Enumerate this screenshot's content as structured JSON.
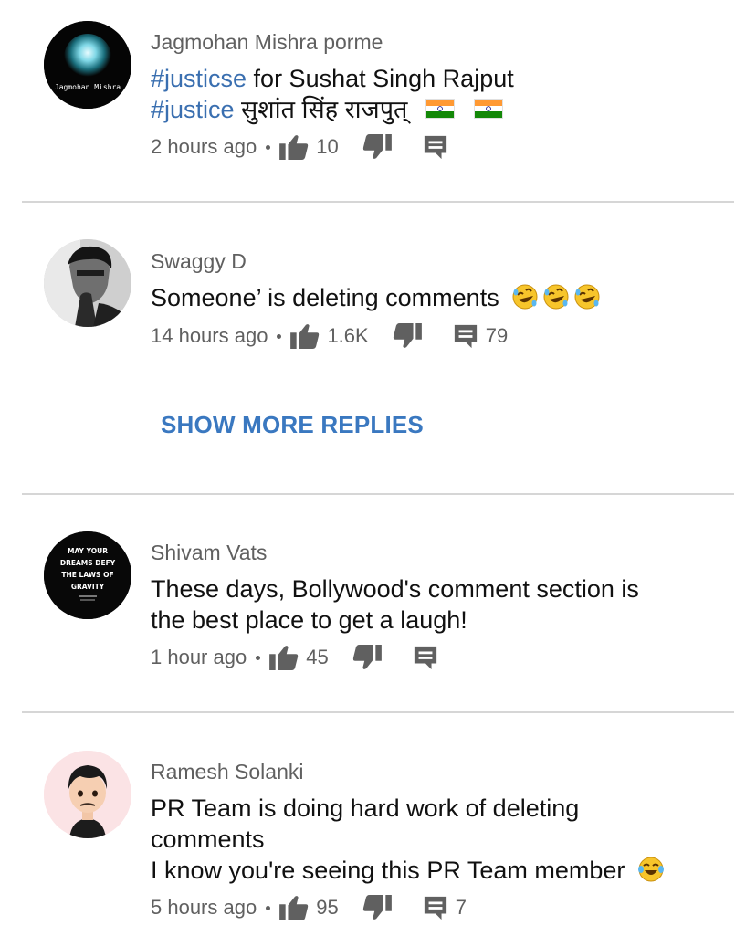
{
  "comments": [
    {
      "author": "Jagmohan Mishra porme",
      "avatar_text": "Jagmohan Mishra",
      "text_line1_hashtag": "#justicse",
      "text_line1_rest": " for Sushat Singh Rajput",
      "text_line2_hashtag": "#justice",
      "text_line2_rest": " सुशांत सिंह राजपुत्",
      "time": "2 hours ago",
      "likes": "10",
      "replies": ""
    },
    {
      "author": "Swaggy D",
      "text": "Someone’ is deleting comments",
      "time": "14 hours ago",
      "likes": "1.6K",
      "replies": "79"
    },
    {
      "author": "Shivam Vats",
      "avatar_lines": [
        "MAY YOUR",
        "DREAMS DEFY",
        "THE LAWS OF",
        "GRAVITY"
      ],
      "text_line1": "These days, Bollywood's comment section is",
      "text_line2": "the best place to get a laugh!",
      "time": "1 hour ago",
      "likes": "45",
      "replies": ""
    },
    {
      "author": "Ramesh Solanki",
      "text_line1": "PR Team is doing hard work of deleting",
      "text_line2": "comments",
      "text_line3": "I know you're seeing this PR Team member",
      "time": "5 hours ago",
      "likes": "95",
      "replies": "7"
    }
  ],
  "show_more_replies": "SHOW MORE REPLIES",
  "colors": {
    "link_blue": "#3a78c0",
    "hashtag_blue": "#3a6fb0",
    "meta_gray": "#606060",
    "divider": "#d6d6d6"
  },
  "icons": [
    "like-icon",
    "dislike-icon",
    "reply-icon",
    "india-flag-icon",
    "rofl-emoji-icon",
    "joy-emoji-icon"
  ]
}
